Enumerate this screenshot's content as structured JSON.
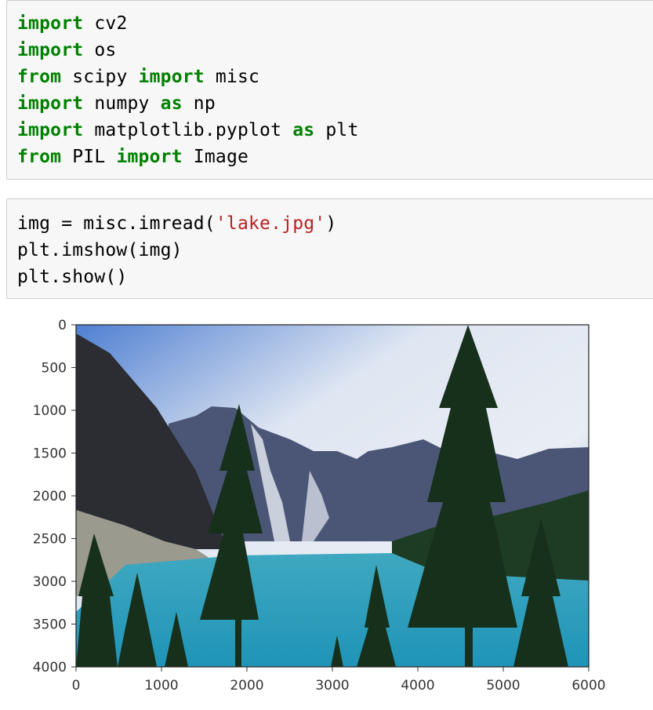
{
  "notebook": {
    "cells": [
      {
        "type": "code",
        "lines": [
          [
            {
              "t": "import",
              "k": "kw"
            },
            {
              "t": " cv2",
              "k": "n"
            }
          ],
          [
            {
              "t": "import",
              "k": "kw"
            },
            {
              "t": " os",
              "k": "n"
            }
          ],
          [
            {
              "t": "from",
              "k": "kw"
            },
            {
              "t": " scipy ",
              "k": "n"
            },
            {
              "t": "import",
              "k": "kw"
            },
            {
              "t": " misc",
              "k": "n"
            }
          ],
          [
            {
              "t": "import",
              "k": "kw"
            },
            {
              "t": " numpy ",
              "k": "n"
            },
            {
              "t": "as",
              "k": "kw"
            },
            {
              "t": " np",
              "k": "n"
            }
          ],
          [
            {
              "t": "import",
              "k": "kw"
            },
            {
              "t": " matplotlib.pyplot ",
              "k": "n"
            },
            {
              "t": "as",
              "k": "kw"
            },
            {
              "t": " plt",
              "k": "n"
            }
          ],
          [
            {
              "t": "from",
              "k": "kw"
            },
            {
              "t": " PIL ",
              "k": "n"
            },
            {
              "t": "import",
              "k": "kw"
            },
            {
              "t": " Image",
              "k": "n"
            }
          ]
        ]
      },
      {
        "type": "code",
        "lines": [
          [
            {
              "t": "img = misc.imread(",
              "k": "n"
            },
            {
              "t": "'lake.jpg'",
              "k": "str"
            },
            {
              "t": ")",
              "k": "n"
            }
          ],
          [
            {
              "t": "plt.imshow(img)",
              "k": "n"
            }
          ],
          [
            {
              "t": "plt.show()",
              "k": "n"
            }
          ]
        ]
      }
    ]
  },
  "output": {
    "image_description": "Photo of a turquoise mountain lake with evergreen trees, snowy peaks and cloudy blue sky",
    "image_icon": "landscape-photo"
  },
  "chart_data": {
    "type": "image",
    "title": "",
    "xlabel": "",
    "ylabel": "",
    "xlim": [
      0,
      6000
    ],
    "ylim": [
      4000,
      0
    ],
    "y_inverted": true,
    "xticks": [
      0,
      1000,
      2000,
      3000,
      4000,
      5000,
      6000
    ],
    "yticks": [
      0,
      500,
      1000,
      1500,
      2000,
      2500,
      3000,
      3500,
      4000
    ],
    "xtick_labels": [
      "0",
      "1000",
      "2000",
      "3000",
      "4000",
      "5000",
      "6000"
    ],
    "ytick_labels": [
      "0",
      "500",
      "1000",
      "1500",
      "2000",
      "2500",
      "3000",
      "3500",
      "4000"
    ],
    "grid": false,
    "legend": null
  },
  "colors": {
    "keyword": "#008000",
    "string": "#ba2121",
    "cell_bg": "#f7f7f7",
    "cell_border": "#cfcfcf"
  }
}
